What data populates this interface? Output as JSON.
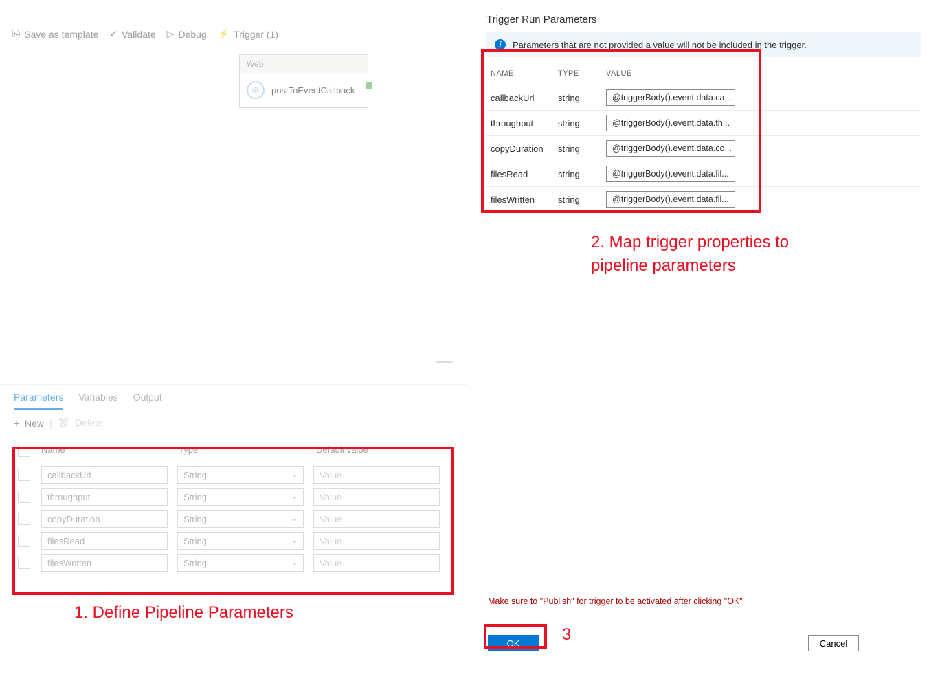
{
  "toolbar": {
    "save_template": "Save as template",
    "validate": "Validate",
    "debug": "Debug",
    "trigger": "Trigger (1)"
  },
  "activity": {
    "header": "Web",
    "name": "postToEventCallback"
  },
  "tabs": {
    "parameters": "Parameters",
    "variables": "Variables",
    "output": "Output"
  },
  "paramToolbar": {
    "new": "New",
    "delete": "Delete"
  },
  "paramGrid": {
    "headers": {
      "name": "Name",
      "type": "Type",
      "default": "Default value"
    },
    "typeOption": "String",
    "valuePlaceholder": "Value",
    "rows": [
      {
        "name": "callbackUrl"
      },
      {
        "name": "throughput"
      },
      {
        "name": "copyDuration"
      },
      {
        "name": "filesRead"
      },
      {
        "name": "filesWritten"
      }
    ]
  },
  "annotations": {
    "one": "1. Define Pipeline Parameters",
    "two": "2. Map trigger properties to pipeline parameters",
    "three": "3"
  },
  "rightPanel": {
    "title": "Trigger Run Parameters",
    "infoMessage": "Parameters that are not provided a value will not be included in the trigger.",
    "headers": {
      "name": "NAME",
      "type": "TYPE",
      "value": "VALUE"
    },
    "rows": [
      {
        "name": "callbackUrl",
        "type": "string",
        "value": "@triggerBody().event.data.ca..."
      },
      {
        "name": "throughput",
        "type": "string",
        "value": "@triggerBody().event.data.th..."
      },
      {
        "name": "copyDuration",
        "type": "string",
        "value": "@triggerBody().event.data.co..."
      },
      {
        "name": "filesRead",
        "type": "string",
        "value": "@triggerBody().event.data.fil..."
      },
      {
        "name": "filesWritten",
        "type": "string",
        "value": "@triggerBody().event.data.fil..."
      }
    ],
    "publishNote": "Make sure to \"Publish\" for trigger to be activated after clicking \"OK\"",
    "ok": "OK",
    "cancel": "Cancel"
  }
}
